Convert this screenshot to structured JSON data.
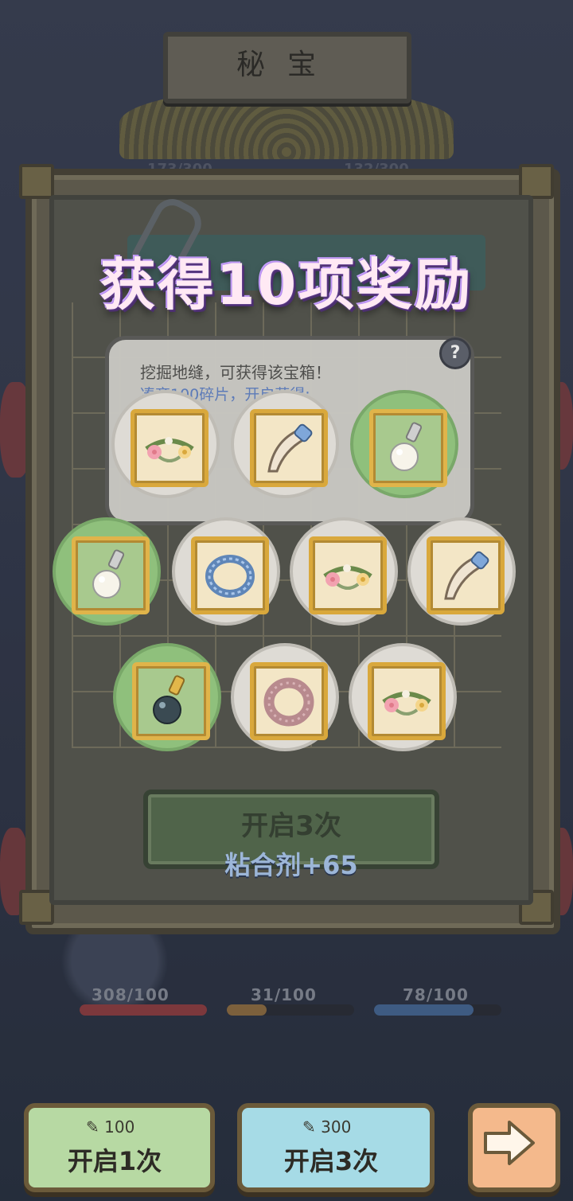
{
  "header": {
    "title": "秘宝"
  },
  "top_counters": [
    "173/300",
    "132/300"
  ],
  "reward_title": "获得10项奖励",
  "popup": {
    "line1": "挖掘地缝，可获得该宝箱！",
    "line2": "凑齐100碎片，开启获得:",
    "help_icon": "?"
  },
  "rewards": [
    {
      "icon": "flower-wreath-icon",
      "rarity": "common"
    },
    {
      "icon": "horn-icon",
      "rarity": "common"
    },
    {
      "icon": "pearl-pendant-icon",
      "rarity": "uncommon"
    },
    {
      "icon": "pearl-pendant-icon",
      "rarity": "uncommon"
    },
    {
      "icon": "blue-ring-icon",
      "rarity": "common"
    },
    {
      "icon": "flower-wreath-icon",
      "rarity": "common"
    },
    {
      "icon": "horn-icon",
      "rarity": "common"
    },
    {
      "icon": "black-pearl-pendant-icon",
      "rarity": "uncommon"
    },
    {
      "icon": "pink-ring-icon",
      "rarity": "common"
    },
    {
      "icon": "flower-wreath-icon",
      "rarity": "common"
    }
  ],
  "panel_button": {
    "label": "开启3次",
    "sub": "粘合剂+65"
  },
  "progress": [
    {
      "label": "308/100",
      "fill": 1.0,
      "color": "#d84a4a"
    },
    {
      "label": "31/100",
      "fill": 0.31,
      "color": "#d89a4a"
    },
    {
      "label": "78/100",
      "fill": 0.78,
      "color": "#5a8fd8"
    }
  ],
  "bottom": {
    "open1": {
      "cost": "100",
      "label": "开启1次"
    },
    "open3": {
      "cost": "300",
      "label": "开启3次"
    },
    "next_icon": "arrow-right-icon"
  },
  "colors": {
    "common_bg": "#dedbd5",
    "uncommon_bg": "#8fc07c",
    "card_border": "#d9a83c"
  }
}
